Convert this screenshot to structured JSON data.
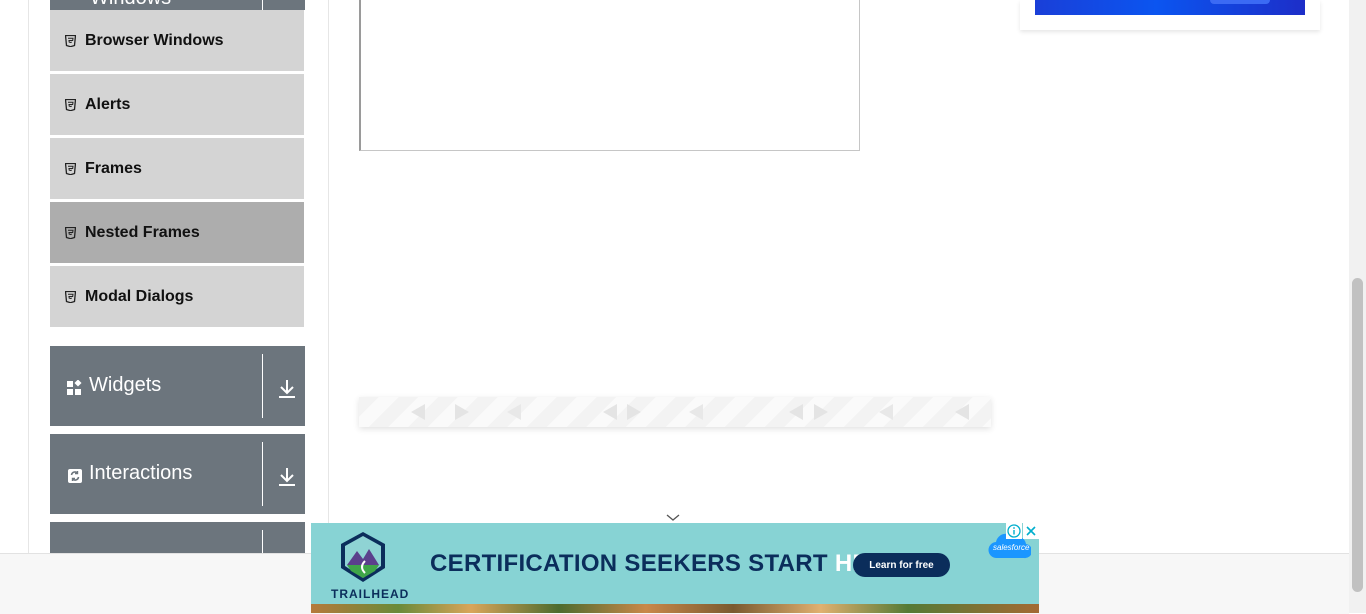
{
  "sidebar": {
    "top_group_title": "Windows",
    "items": [
      {
        "label": "Browser Windows",
        "active": false
      },
      {
        "label": "Alerts",
        "active": false
      },
      {
        "label": "Frames",
        "active": false
      },
      {
        "label": "Nested Frames",
        "active": true
      },
      {
        "label": "Modal Dialogs",
        "active": false
      }
    ],
    "groups": [
      {
        "title": "Widgets",
        "icon": "widgets-icon"
      },
      {
        "title": "Interactions",
        "icon": "interactions-icon"
      }
    ]
  },
  "ad": {
    "brand": "TRAILHEAD",
    "headline_main": "CERTIFICATION SEEKERS START ",
    "headline_highlight": "HERE.",
    "cta": "Learn for free",
    "sponsor": "salesforce"
  },
  "colors": {
    "group_bg": "#6c757d",
    "item_bg": "#d4d4d4",
    "item_active_bg": "#adadad",
    "ad_bg": "#87d3d4",
    "ad_navy": "#0b2d5b"
  }
}
